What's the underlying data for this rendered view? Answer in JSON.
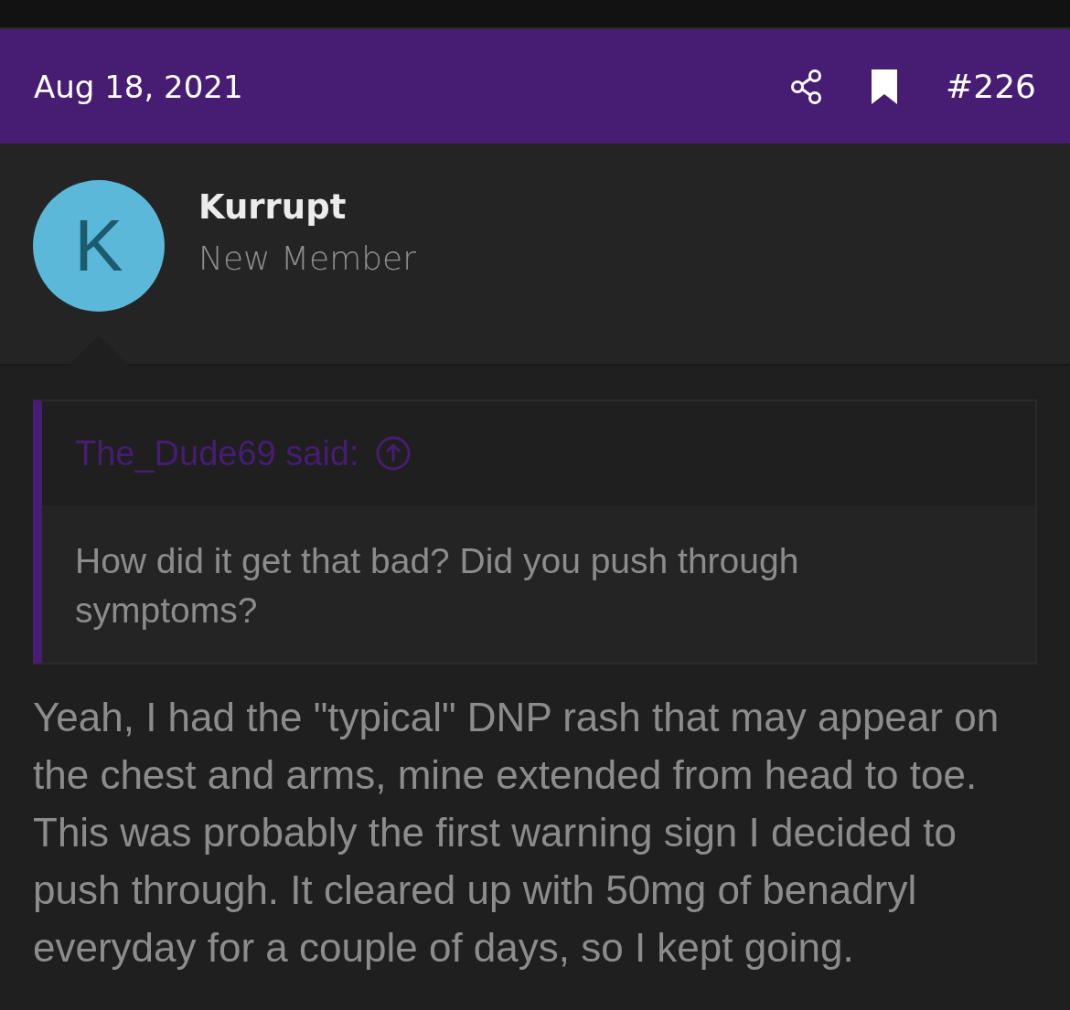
{
  "header": {
    "date": "Aug 18, 2021",
    "post_number": "#226"
  },
  "author": {
    "initial": "K",
    "name": "Kurrupt",
    "role": "New Member"
  },
  "quote": {
    "attribution": "The_Dude69 said:",
    "text": "How did it get that bad? Did you push through symptoms?"
  },
  "body": "Yeah, I had the \"typical\" DNP rash that may appear on the chest and arms, mine extended from head to toe. This was probably the first warning sign I decided to push through. It cleared up with 50mg of benadryl everyday for a couple of days, so I kept going."
}
